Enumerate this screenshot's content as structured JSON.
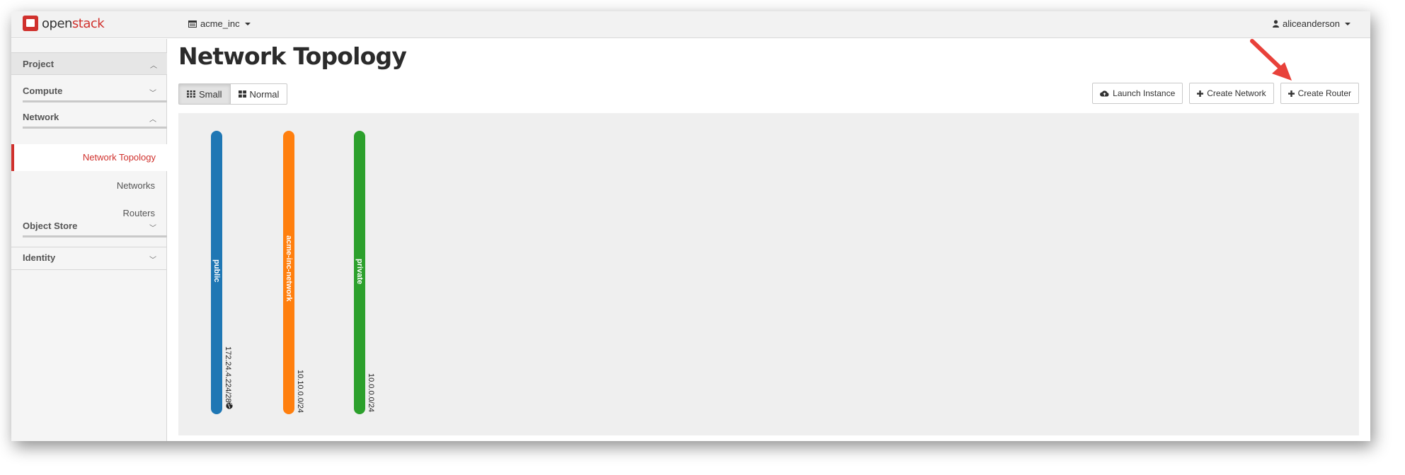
{
  "brand": {
    "logo_part1": "open",
    "logo_part2": "stack",
    "accent_color": "#d0312d"
  },
  "header": {
    "project": "acme_inc",
    "user": "aliceanderson"
  },
  "sidebar": {
    "project_label": "Project",
    "compute_label": "Compute",
    "network_label": "Network",
    "network_items": [
      {
        "label": "Network Topology",
        "active": true
      },
      {
        "label": "Networks",
        "active": false
      },
      {
        "label": "Routers",
        "active": false
      }
    ],
    "object_store_label": "Object Store",
    "identity_label": "Identity"
  },
  "main": {
    "title": "Network Topology",
    "view_toggle": {
      "small_label": "Small",
      "normal_label": "Normal",
      "selected": "Small"
    },
    "actions": {
      "launch_instance": "Launch Instance",
      "create_network": "Create Network",
      "create_router": "Create Router"
    }
  },
  "topology": {
    "networks": [
      {
        "name": "public",
        "cidr": "172.24.4.224/28",
        "color": "#1f77b4",
        "external": true
      },
      {
        "name": "acme-inc-network",
        "cidr": "10.10.0.0/24",
        "color": "#ff7f0e",
        "external": false
      },
      {
        "name": "private",
        "cidr": "10.0.0.0/24",
        "color": "#2ca02c",
        "external": false
      }
    ]
  }
}
